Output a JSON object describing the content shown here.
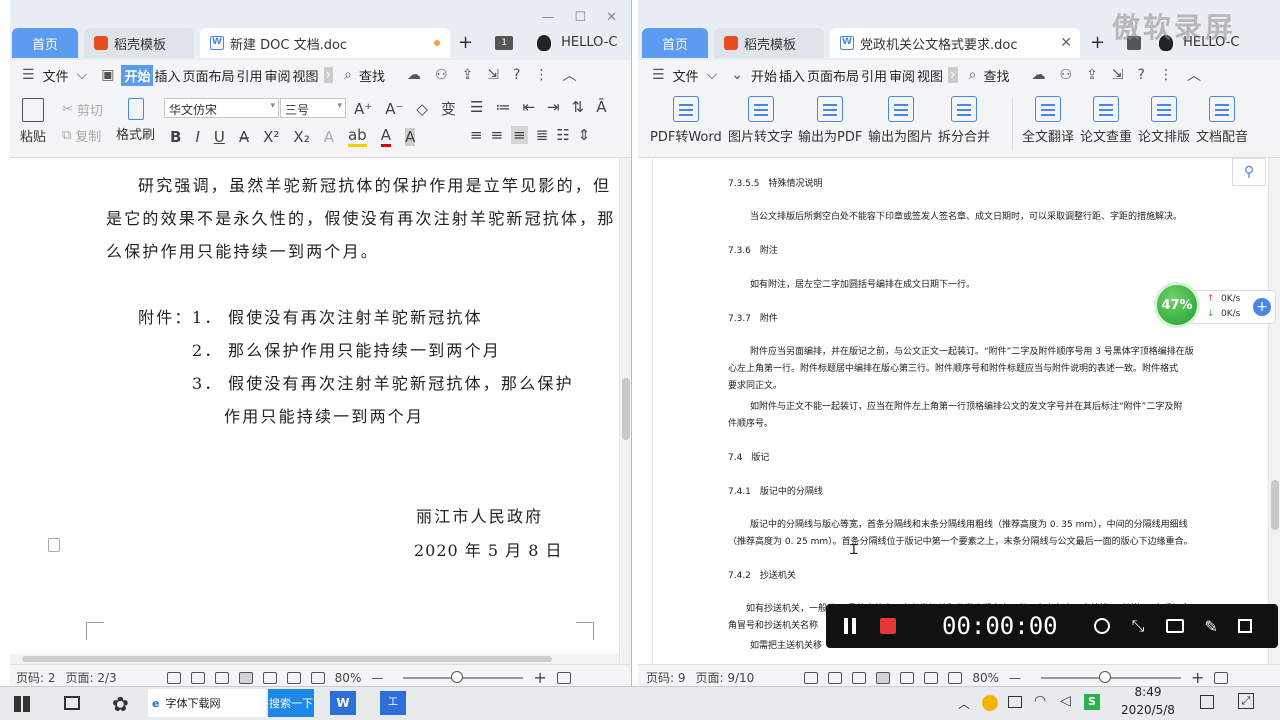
{
  "left": {
    "tabs": {
      "home": "首页",
      "template": "稻壳模板",
      "doc": "新建 DOC 文档.doc"
    },
    "title_extra": {
      "badge": "1",
      "user": "HELLO-C"
    },
    "menu": [
      "文件",
      "开始",
      "插入",
      "页面布局",
      "引用",
      "审阅",
      "视图"
    ],
    "search": "查找",
    "ribbon": {
      "paste": "粘贴",
      "cut": "剪切",
      "copy": "复制",
      "format_painter": "格式刷",
      "font": "华文仿宋",
      "size": "三号"
    },
    "body": {
      "p1": [
        "研究强调，虽然羊驼新冠抗体的保护作用是立竿见影的，但",
        "是它的效果不是永久性的，假使没有再次注射羊驼新冠抗体，那",
        "么保护作用只能持续一到两个月。"
      ],
      "att_label": "附件：",
      "att": [
        {
          "n": "1．",
          "t": "假使没有再次注射羊驼新冠抗体"
        },
        {
          "n": "2．",
          "t": "那么保护作用只能持续一到两个月"
        },
        {
          "n": "3．",
          "t": "假使没有再次注射羊驼新冠抗体，那么保护"
        }
      ],
      "att3b": "作用只能持续一到两个月",
      "org": "丽江市人民政府",
      "date": "2020 年 5 月 8 日"
    },
    "status": {
      "page": "页码: 2",
      "pages": "页面: 2/3",
      "zoom": "80%"
    }
  },
  "right": {
    "tabs": {
      "home": "首页",
      "template": "稻壳模板",
      "doc": "党政机关公文格式要求.doc"
    },
    "title_extra": {
      "user": "HELLO-C"
    },
    "menu": [
      "文件",
      "开始",
      "插入",
      "页面布局",
      "引用",
      "审阅",
      "视图"
    ],
    "search": "查找",
    "ribbon": [
      "PDF转Word",
      "图片转文字",
      "输出为PDF",
      "输出为图片",
      "拆分合并",
      "全文翻译",
      "论文查重",
      "论文排版",
      "文档配音"
    ],
    "body": {
      "h1": "7.3.5.5　特殊情况说明",
      "t1": "当公文排版后所剩空白处不能容下印章或签发人签名章、成文日期时，可以采取调整行距、字距的措施解决。",
      "h2": "7.3.6　附注",
      "t2": "如有附注，居左空二字加圆括号编排在成文日期下一行。",
      "h3": "7.3.7　附件",
      "t3a": "附件应当另面编排，并在版记之前，与公文正文一起装订。“附件”二字及附件顺序号用 3 号黑体字顶格编排在版",
      "t3b": "心左上角第一行。附件标题居中编排在版心第三行。附件顺序号和附件标题应当与附件说明的表述一致。附件格式",
      "t3c": "要求同正文。",
      "t4a": "如附件与正文不能一起装订，应当在附件左上角第一行顶格编排公文的发文字号并在其后标注“附件”二字及附",
      "t4b": "件顺序号。",
      "h4": "7.4　版记",
      "h5": "7.4.1　版记中的分隔线",
      "t5a": "版记中的分隔线与版心等宽，首条分隔线和末条分隔线用粗线（推荐高度为 0. 35 mm），中间的分隔线用细线",
      "t5b": "（推荐高度为 0. 25 mm）。首条分隔线位于版记中第一个要素之上，末条分隔线与公文最后一面的版心下边缘重合。",
      "h6": "7.4.2　抄送机关",
      "t6a": "如有抄送机关，一般用 4 号仿宋体字，在印发机关和印发日期之上一行、左右各空一字编排。“抄送”二字后加全",
      "t6b": "角冒号和抄送机关名称",
      "t6c": "如需把主送机关移"
    },
    "status": {
      "page": "页码: 9",
      "pages": "页面: 9/10",
      "zoom": "80%"
    }
  },
  "widget": {
    "percent": "47%",
    "up": "0K/s",
    "down": "0K/s"
  },
  "recorder": {
    "time": "00:00:00"
  },
  "watermark": "傲软录屏",
  "taskbar": {
    "app1": "字体下载网",
    "search": "搜索一下",
    "time": "8:49",
    "date": "2020/5/8"
  }
}
